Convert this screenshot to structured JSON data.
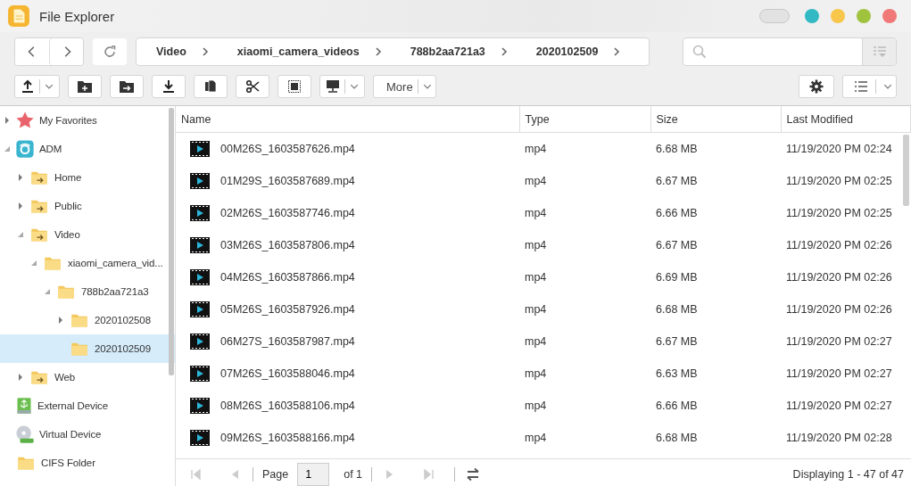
{
  "window": {
    "title": "File Explorer"
  },
  "breadcrumb": [
    "Video",
    "xiaomi_camera_videos",
    "788b2aa721a3",
    "2020102509"
  ],
  "toolbar": {
    "more_label": "More"
  },
  "tree": [
    {
      "label": "My Favorites",
      "kind": "favorites",
      "expanded": false,
      "selected": false
    },
    {
      "label": "ADM",
      "kind": "adm",
      "expanded": true,
      "selected": false,
      "children": [
        {
          "label": "Home",
          "kind": "share",
          "expanded": false,
          "selected": false
        },
        {
          "label": "Public",
          "kind": "share",
          "expanded": false,
          "selected": false
        },
        {
          "label": "Video",
          "kind": "share",
          "expanded": true,
          "selected": false,
          "children": [
            {
              "label": "xiaomi_camera_vid...",
              "kind": "folder",
              "expanded": true,
              "selected": false,
              "children": [
                {
                  "label": "788b2aa721a3",
                  "kind": "folder",
                  "expanded": true,
                  "selected": false,
                  "children": [
                    {
                      "label": "2020102508",
                      "kind": "folder",
                      "expanded": false,
                      "selected": false
                    },
                    {
                      "label": "2020102509",
                      "kind": "folder",
                      "selected": true
                    }
                  ]
                }
              ]
            }
          ]
        },
        {
          "label": "Web",
          "kind": "share",
          "expanded": false,
          "selected": false
        }
      ]
    },
    {
      "label": "External Device",
      "kind": "usb",
      "selected": false
    },
    {
      "label": "Virtual Device",
      "kind": "disc",
      "selected": false
    },
    {
      "label": "CIFS Folder",
      "kind": "folder",
      "selected": false
    }
  ],
  "table": {
    "columns": [
      "Name",
      "Type",
      "Size",
      "Last Modified"
    ],
    "rows": [
      [
        "00M26S_1603587626.mp4",
        "mp4",
        "6.68 MB",
        "11/19/2020 PM 02:24"
      ],
      [
        "01M29S_1603587689.mp4",
        "mp4",
        "6.67 MB",
        "11/19/2020 PM 02:25"
      ],
      [
        "02M26S_1603587746.mp4",
        "mp4",
        "6.66 MB",
        "11/19/2020 PM 02:25"
      ],
      [
        "03M26S_1603587806.mp4",
        "mp4",
        "6.67 MB",
        "11/19/2020 PM 02:26"
      ],
      [
        "04M26S_1603587866.mp4",
        "mp4",
        "6.69 MB",
        "11/19/2020 PM 02:26"
      ],
      [
        "05M26S_1603587926.mp4",
        "mp4",
        "6.68 MB",
        "11/19/2020 PM 02:26"
      ],
      [
        "06M27S_1603587987.mp4",
        "mp4",
        "6.67 MB",
        "11/19/2020 PM 02:27"
      ],
      [
        "07M26S_1603588046.mp4",
        "mp4",
        "6.63 MB",
        "11/19/2020 PM 02:27"
      ],
      [
        "08M26S_1603588106.mp4",
        "mp4",
        "6.66 MB",
        "11/19/2020 PM 02:27"
      ],
      [
        "09M26S_1603588166.mp4",
        "mp4",
        "6.68 MB",
        "11/19/2020 PM 02:28"
      ]
    ]
  },
  "pager": {
    "page_label": "Page",
    "page_value": "1",
    "of_label": "of 1",
    "summary": "Displaying 1 - 47 of 47"
  }
}
